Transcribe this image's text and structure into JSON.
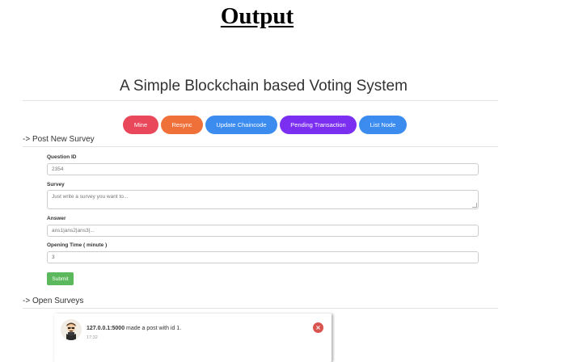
{
  "heading": "Output",
  "app": {
    "title": "A Simple Blockchain based Voting System"
  },
  "toolbar": {
    "mine": "Mine",
    "resync": "Resync",
    "update_chaincode": "Update Chaincode",
    "pending_transaction": "Pending Transaction",
    "list_node": "List Node"
  },
  "colors": {
    "mine": "#e8485a",
    "resync": "#f0703a",
    "update_chaincode": "#3c8cf0",
    "pending_transaction": "#7b2ff0",
    "list_node": "#3c8cf0",
    "submit": "#5cb85c",
    "close": "#d9534f"
  },
  "post_survey": {
    "section_title": "-> Post New Survey",
    "question_id_label": "Question ID",
    "question_id_placeholder": "2354",
    "survey_label": "Survey",
    "survey_placeholder": "Just write a survey you want to...",
    "answer_label": "Answer",
    "answer_placeholder": "ans1|ans2|ans3|...",
    "opening_time_label": "Opening Time ( minute )",
    "opening_time_value": "3",
    "submit": "Submit"
  },
  "open_surveys": {
    "section_title": "-> Open Surveys",
    "posts": [
      {
        "author": "127.0.0.1:5000",
        "message": " made a post with id 1.",
        "time": "17:32",
        "avatar_icon": "user-avatar-icon",
        "close_icon": "close-icon"
      }
    ]
  }
}
